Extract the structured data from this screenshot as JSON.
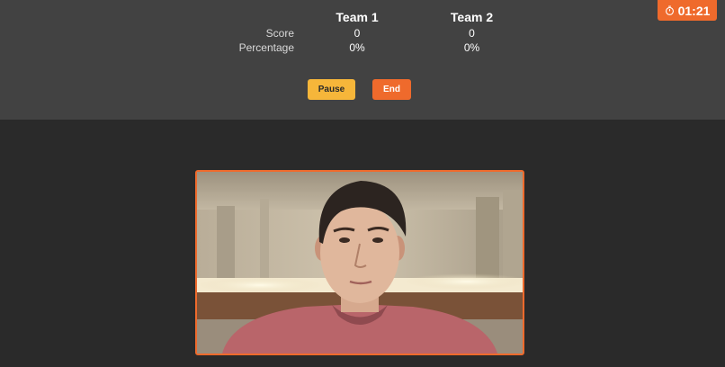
{
  "timer": {
    "value": "01:21",
    "icon": "stopwatch-icon"
  },
  "scoreboard": {
    "teams": [
      "Team 1",
      "Team 2"
    ],
    "rows": [
      {
        "label": "Score",
        "values": [
          "0",
          "0"
        ]
      },
      {
        "label": "Percentage",
        "values": [
          "0%",
          "0%"
        ]
      }
    ]
  },
  "controls": {
    "pause_label": "Pause",
    "end_label": "End"
  },
  "colors": {
    "accent": "#ef6a2c",
    "pause": "#f6b63a",
    "panel": "#424242",
    "background": "#2a2a2a"
  }
}
